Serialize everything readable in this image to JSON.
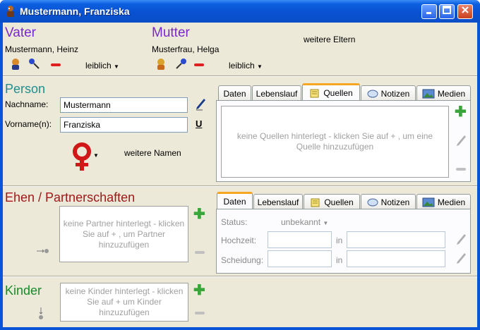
{
  "window": {
    "title": "Mustermann, Franziska"
  },
  "father": {
    "heading": "Vater",
    "name": "Mustermann, Heinz",
    "relation": "leiblich"
  },
  "mother": {
    "heading": "Mutter",
    "name": "Musterfrau, Helga",
    "relation": "leiblich"
  },
  "more_parents": "weitere Eltern",
  "person": {
    "heading": "Person",
    "surname_label": "Nachname:",
    "surname": "Mustermann",
    "firstname_label": "Vorname(n):",
    "firstname": "Franziska",
    "more_names": "weitere Namen",
    "underline_btn": "U"
  },
  "person_tabs": {
    "tabs": [
      "Daten",
      "Lebenslauf",
      "Quellen",
      "Notizen",
      "Medien"
    ],
    "active": "Quellen",
    "empty_text": "keine Quellen hinterlegt - klicken Sie auf + , um eine Quelle hinzuzufügen"
  },
  "marriages": {
    "heading": "Ehen / Partnerschaften",
    "empty_text": "keine Partner hinterlegt - klicken Sie auf + , um Partner hinzuzufügen",
    "tabs": [
      "Daten",
      "Lebenslauf",
      "Quellen",
      "Notizen",
      "Medien"
    ],
    "active": "Daten",
    "status_label": "Status:",
    "status_value": "unbekannt",
    "wedding_label": "Hochzeit:",
    "divorce_label": "Scheidung:",
    "in_label": "in"
  },
  "children": {
    "heading": "Kinder",
    "empty_text": "keine Kinder hinterlegt - klicken Sie auf + um Kinder hinzuzufügen"
  },
  "colors": {
    "accent_purple": "#7a28c8",
    "accent_teal": "#1f8f8f",
    "accent_red": "#a01818",
    "accent_green": "#1a8a2a",
    "female_symbol": "#d01818"
  }
}
